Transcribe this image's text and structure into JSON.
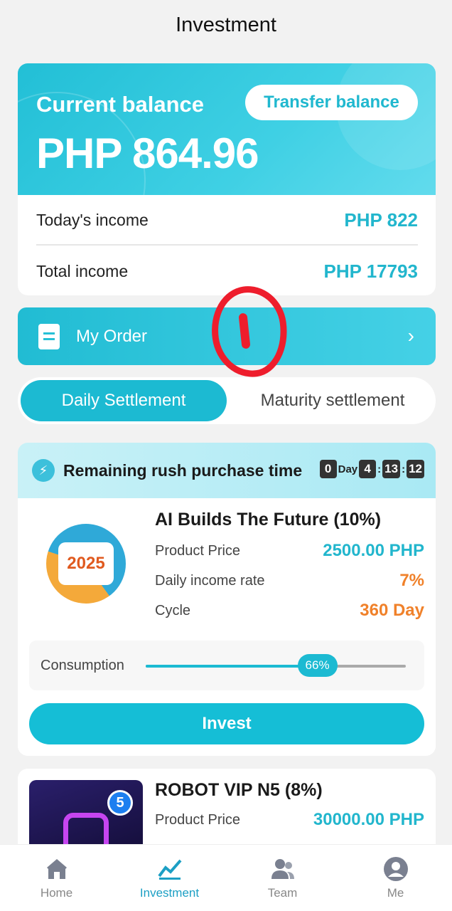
{
  "header": {
    "title": "Investment"
  },
  "balance": {
    "label": "Current balance",
    "amount": "PHP 864.96",
    "transfer_label": "Transfer balance"
  },
  "income": {
    "today_label": "Today's income",
    "today_value": "PHP 822",
    "total_label": "Total income",
    "total_value": "PHP 17793"
  },
  "order": {
    "label": "My Order"
  },
  "tabs": [
    {
      "label": "Daily Settlement",
      "active": true
    },
    {
      "label": "Maturity settlement",
      "active": false
    }
  ],
  "rush": {
    "label": "Remaining rush purchase time",
    "days": "0",
    "day_unit": "Day",
    "hours": "4",
    "minutes": "13",
    "seconds": "12"
  },
  "products": [
    {
      "title": "AI Builds The Future (10%)",
      "price_label": "Product Price",
      "price_value": "2500.00 PHP",
      "rate_label": "Daily income rate",
      "rate_value": "7%",
      "cycle_label": "Cycle",
      "cycle_value": "360 Day",
      "consumption_label": "Consumption",
      "consumption_percent": 66,
      "consumption_text": "66%",
      "invest_label": "Invest",
      "image_icon": "ai-2025-logo-icon"
    },
    {
      "title": "ROBOT VIP N5 (8%)",
      "price_label": "Product Price",
      "price_value": "30000.00 PHP",
      "image_icon": "robot-n5-logo-icon",
      "badge": "5"
    }
  ],
  "nav": [
    {
      "label": "Home",
      "icon": "home-icon",
      "active": false
    },
    {
      "label": "Investment",
      "icon": "chart-icon",
      "active": true
    },
    {
      "label": "Team",
      "icon": "team-icon",
      "active": false
    },
    {
      "label": "Me",
      "icon": "user-icon",
      "active": false
    }
  ],
  "colors": {
    "accent": "#1cbad2",
    "orange": "#f0812a",
    "annotation": "#ee1d2c"
  }
}
